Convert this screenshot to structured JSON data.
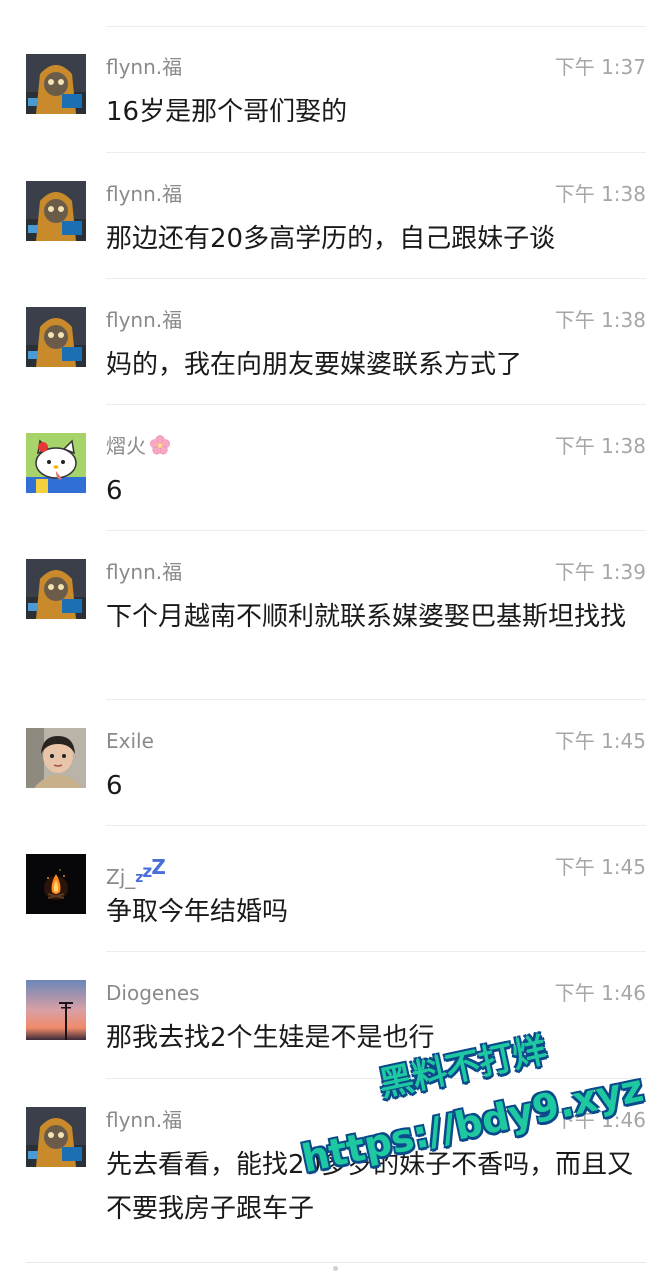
{
  "messages": [
    {
      "name": "flynn.福",
      "time": "下午 1:37",
      "text": "16岁是那个哥们娶的",
      "avatar": "hooded-cat-avatar"
    },
    {
      "name": "flynn.福",
      "time": "下午 1:38",
      "text": "那边还有20多高学历的，自己跟妹子谈",
      "avatar": "hooded-cat-avatar"
    },
    {
      "name": "flynn.福",
      "time": "下午 1:38",
      "text": "妈的，我在向朋友要媒婆联系方式了",
      "avatar": "hooded-cat-avatar"
    },
    {
      "name": "熠火",
      "time": "下午 1:38",
      "text": "6",
      "avatar": "hello-kitty-avatar",
      "name_emoji": "cherry-blossom-icon"
    },
    {
      "name": "flynn.福",
      "time": "下午 1:39",
      "text": "下个月越南不顺利就联系媒婆娶巴基斯坦找找",
      "avatar": "hooded-cat-avatar"
    },
    {
      "name": "Exile",
      "time": "下午 1:45",
      "text": "6",
      "avatar": "child-photo-avatar"
    },
    {
      "name": "Zj_",
      "time": "下午 1:45",
      "text": "争取今年结婚吗",
      "avatar": "bonfire-avatar",
      "name_suffix": "zzz"
    },
    {
      "name": "Diogenes",
      "time": "下午 1:46",
      "text": "那我去找2个生娃是不是也行",
      "avatar": "sunset-pole-avatar"
    },
    {
      "name": "flynn.福",
      "time": "下午 1:46",
      "text": "先去看看，能找20多岁的妹子不香吗，而且又不要我房子跟车子",
      "avatar": "hooded-cat-avatar"
    }
  ],
  "watermark": {
    "line1": "黑料不打烊",
    "line2": "https://bdy9.xyz"
  },
  "colors": {
    "name": "#8a8a8a",
    "time": "#a6a6a6",
    "text": "#1a1a1a",
    "divider": "#ececec",
    "watermark": "#1ec8a0"
  }
}
